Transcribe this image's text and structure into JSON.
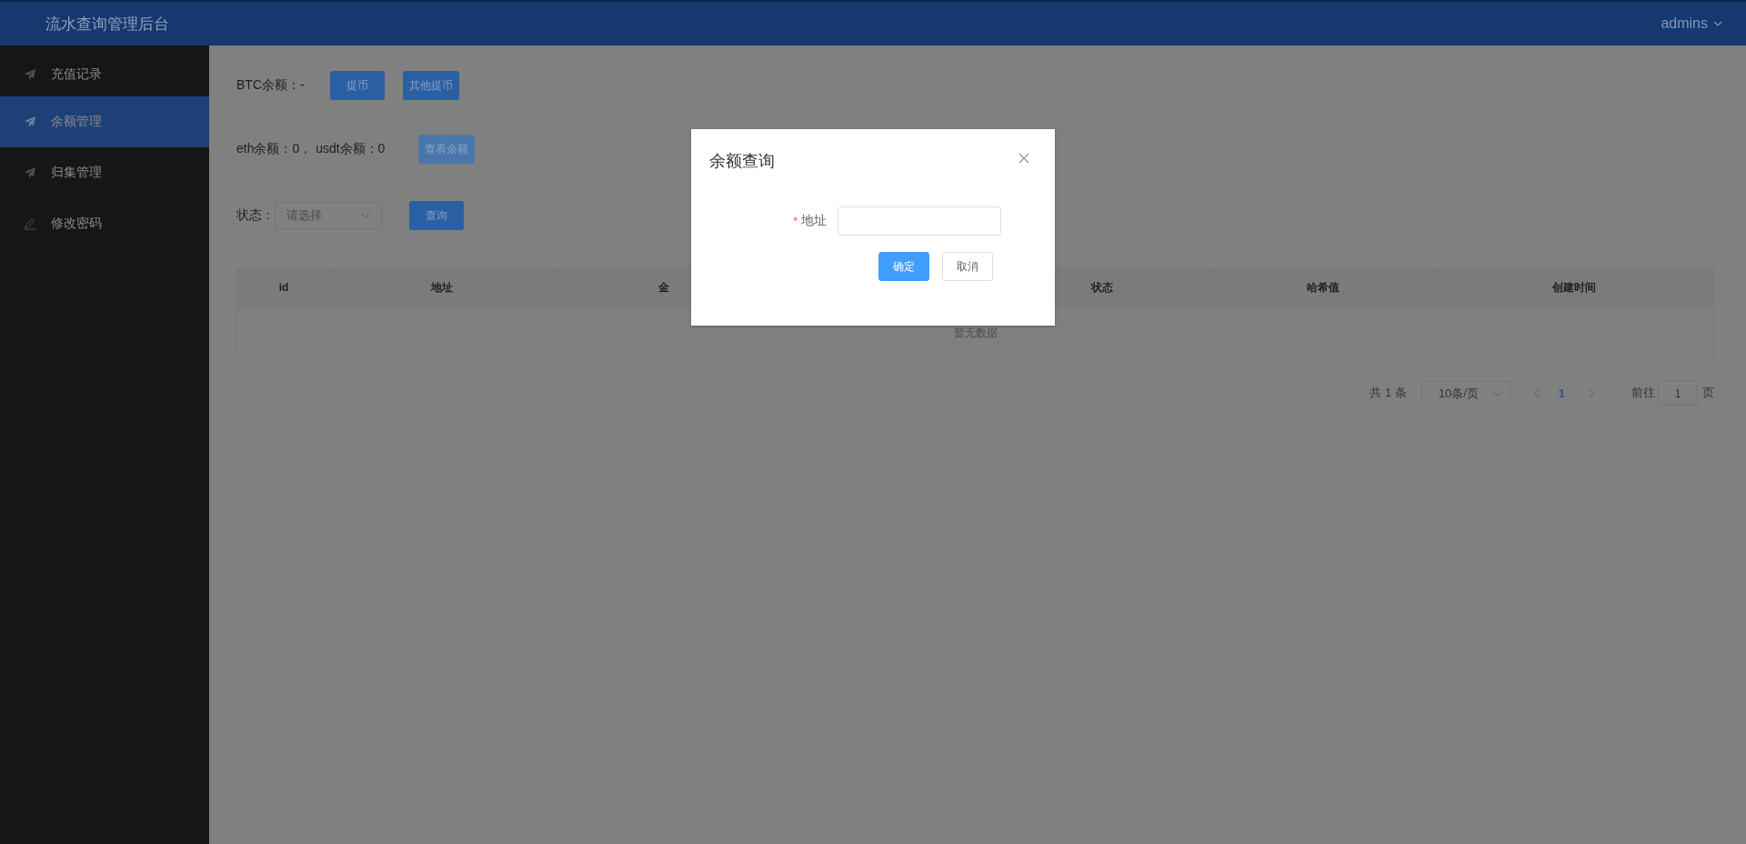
{
  "header": {
    "title": "流水查询管理后台",
    "user": "admins"
  },
  "sidebar": {
    "items": [
      {
        "label": "充值记录",
        "selected": false
      },
      {
        "label": "余额管理",
        "selected": true
      },
      {
        "label": "归集管理",
        "selected": false
      },
      {
        "label": "修改密码",
        "selected": false
      }
    ]
  },
  "balances": {
    "btc_text": "BTC余额：-",
    "withdraw_button": "提币",
    "other_withdraw_button": "其他提币",
    "eth_usdt_text": "eth余额：0， usdt余额：0",
    "check_button": {
      "label": "查看余额",
      "disabled": true
    }
  },
  "filter": {
    "label": "状态：",
    "placeholder": "请选择",
    "query_button": "查询"
  },
  "table": {
    "columns": [
      "id",
      "地址",
      "金",
      "状态",
      "哈希值",
      "创建时间"
    ],
    "empty_text": "暂无数据"
  },
  "pagination": {
    "total": "共 1 条",
    "page_size": "10条/页",
    "pages": [
      {
        "label": "1",
        "selected": true
      }
    ],
    "goto_label": "前往",
    "goto_value": "1",
    "goto_suffix": "页"
  },
  "dialog": {
    "title": "余额查询",
    "field": {
      "label": "地址",
      "required_mark": "*"
    },
    "buttons": [
      {
        "label": "确定",
        "kind": "primary"
      },
      {
        "label": "取消",
        "kind": "default"
      }
    ]
  }
}
